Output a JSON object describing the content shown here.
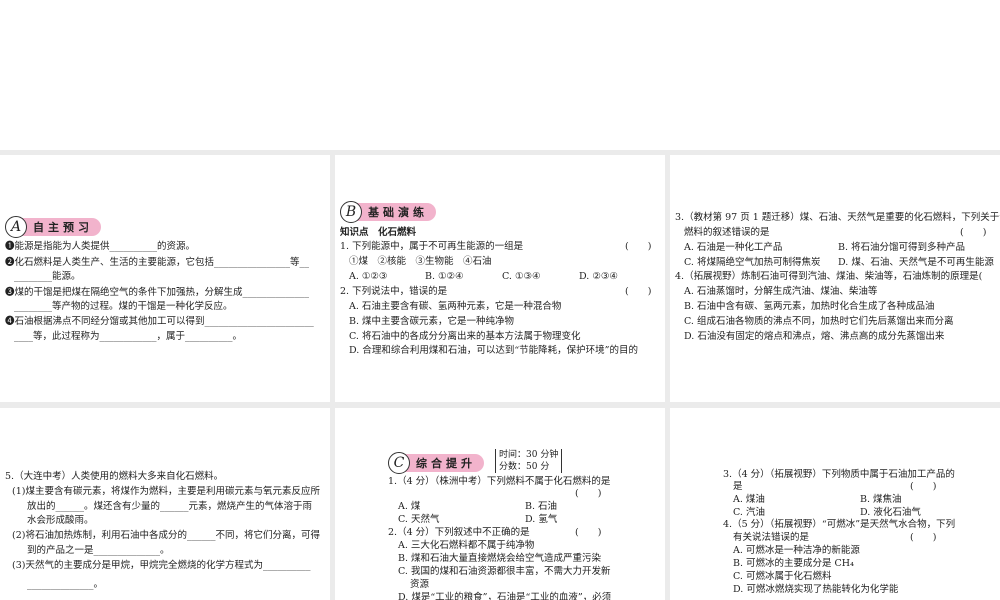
{
  "panelA": {
    "letter": "A",
    "title": "自主预习",
    "lines": [
      "❶能源是指能为人类提供__________的资源。",
      "❷化石燃料是人类生产、生活的主要能源，它包括________________等__",
      "________能源。",
      "❸煤的干馏是把煤在隔绝空气的条件下加强热，分解生成______________",
      "________等产物的过程。煤的干馏是一种化学反应。",
      "❹石油根据沸点不同经分馏或其他加工可以得到_______________________",
      "____等，此过程称为____________，属于__________。"
    ]
  },
  "panelB": {
    "letter": "B",
    "title": "基础演练",
    "topic": "知识点　化石燃料",
    "q1": "1. 下列能源中，属于不可再生能源的一组是",
    "paren": "(　　)",
    "q1_items": "①煤　②核能　③生物能　④石油",
    "q1_opts": [
      "A. ①②③",
      "B. ①②④",
      "C. ①③④",
      "D. ②③④"
    ],
    "q2": "2. 下列说法中，错误的是",
    "q2_opts": [
      "A. 石油主要含有碳、氢两种元素，它是一种混合物",
      "B. 煤中主要含碳元素，它是一种纯净物",
      "C. 将石油中的各成分分离出来的基本方法属于物理变化",
      "D. 合理和综合利用煤和石油，可以达到“节能降耗，保护环境”的目的"
    ]
  },
  "panelB2": {
    "q3a": "3.（教材第 97 页 1 题迁移）煤、石油、天然气是重要的化石燃料，下列关于化石",
    "q3b": "燃料的叙述错误的是",
    "paren": "(　　)",
    "q3_opts": [
      "A. 石油是一种化工产品",
      "B. 将石油分馏可得到多种产品",
      "C. 将煤隔绝空气加热可制得焦炭",
      "D. 煤、石油、天然气是不可再生能源"
    ],
    "q4": "4.（拓展视野）炼制石油可得到汽油、煤油、柴油等，石油炼制的原理是(　　)",
    "q4_opts": [
      "A. 石油蒸馏时，分解生成汽油、煤油、柴油等",
      "B. 石油中含有碳、氢两元素，加热时化合生成了各种成品油",
      "C. 组成石油各物质的沸点不同，加热时它们先后蒸馏出来而分离",
      "D. 石油没有固定的熔点和沸点，熔、沸点高的成分先蒸馏出来"
    ]
  },
  "panelB3": {
    "lines": [
      "5.（大连中考）人类使用的燃料大多来自化石燃料。",
      "(1)煤主要含有碳元素，将煤作为燃料，主要是利用碳元素与氧元素反应所",
      "放出的______。煤还含有少量的______元素，燃烧产生的气体溶于雨",
      "水会形成酸雨。",
      "(2)将石油加热炼制，利用石油中各成分的______不同，将它们分离，可得",
      "到的产品之一是______________。",
      "(3)天然气的主要成分是甲烷，甲烷完全燃烧的化学方程式为__________",
      "______________。"
    ]
  },
  "panelC": {
    "letter": "C",
    "title": "综合提升",
    "time": "时间：30 分钟",
    "score": "分数：50 分",
    "q1": "1.（4 分）（株洲中考）下列燃料不属于化石燃料的是",
    "paren": "(　　)",
    "q1_opts": [
      "A. 煤",
      "B. 石油",
      "C. 天然气",
      "D. 氢气"
    ],
    "q2": "2.（4 分）下列叙述中不正确的是",
    "q2_opts": [
      "A. 三大化石燃料都不属于纯净物",
      "B. 煤和石油大量直接燃烧会给空气造成严重污染",
      "C. 我国的煤和石油资源都很丰富，不需大力开发新",
      "资源",
      "D. 煤是“工业的粮食”，石油是“工业的血液”，必须"
    ]
  },
  "panelC2": {
    "q3a": "3.（4 分）（拓展视野）下列物质中属于石油加工产品的",
    "q3b": "是",
    "paren": "(　　)",
    "q3_opts": [
      "A. 煤油",
      "B. 煤焦油",
      "C. 汽油",
      "D. 液化石油气"
    ],
    "q4a": "4.（5 分）（拓展视野）“可燃冰”是天然气水合物，下列",
    "q4b": "有关说法错误的是",
    "q4_opts": [
      "A. 可燃冰是一种洁净的新能源",
      "B. 可燃冰的主要成分是 CH₄",
      "C. 可燃冰属于化石燃料",
      "D. 可燃冰燃烧实现了热能转化为化学能"
    ]
  }
}
